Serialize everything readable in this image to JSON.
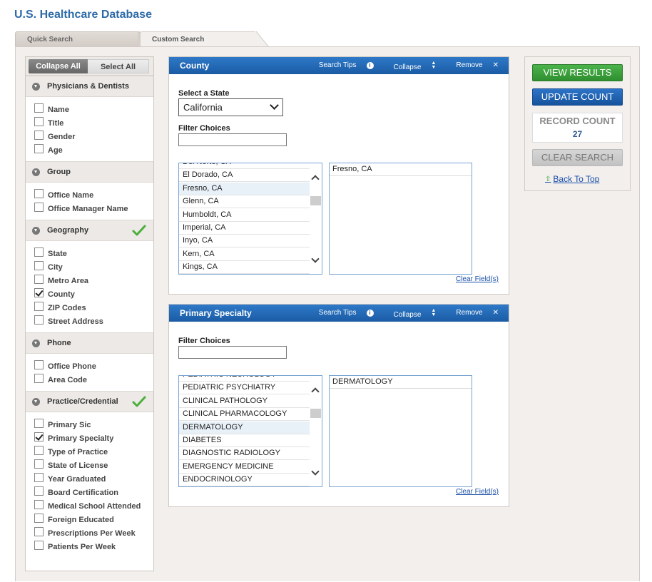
{
  "app": {
    "title": "U.S. Healthcare Database"
  },
  "tabs": [
    {
      "label": "Quick Search"
    },
    {
      "label": "Custom Search"
    }
  ],
  "left_panel": {
    "collapse_all": "Collapse All",
    "select_all": "Select All",
    "groups": [
      {
        "title": "Physicians & Dentists",
        "checked_mark": false,
        "items": [
          {
            "label": "Name",
            "checked": false
          },
          {
            "label": "Title",
            "checked": false
          },
          {
            "label": "Gender",
            "checked": false
          },
          {
            "label": "Age",
            "checked": false
          }
        ]
      },
      {
        "title": "Group",
        "checked_mark": false,
        "items": [
          {
            "label": "Office Name",
            "checked": false
          },
          {
            "label": "Office Manager Name",
            "checked": false
          }
        ]
      },
      {
        "title": "Geography",
        "checked_mark": true,
        "items": [
          {
            "label": "State",
            "checked": false
          },
          {
            "label": "City",
            "checked": false
          },
          {
            "label": "Metro Area",
            "checked": false
          },
          {
            "label": "County",
            "checked": true
          },
          {
            "label": "ZIP Codes",
            "checked": false
          },
          {
            "label": "Street Address",
            "checked": false
          }
        ]
      },
      {
        "title": "Phone",
        "checked_mark": false,
        "items": [
          {
            "label": "Office Phone",
            "checked": false
          },
          {
            "label": "Area Code",
            "checked": false
          }
        ]
      },
      {
        "title": "Practice/Credential",
        "checked_mark": true,
        "items": [
          {
            "label": "Primary Sic",
            "checked": false
          },
          {
            "label": "Primary Specialty",
            "checked": true
          },
          {
            "label": "Type of Practice",
            "checked": false
          },
          {
            "label": "State of License",
            "checked": false
          },
          {
            "label": "Year Graduated",
            "checked": false
          },
          {
            "label": "Board Certification",
            "checked": false
          },
          {
            "label": "Medical School Attended",
            "checked": false
          },
          {
            "label": "Foreign Educated",
            "checked": false
          },
          {
            "label": "Prescriptions Per Week",
            "checked": false
          },
          {
            "label": "Patients Per Week",
            "checked": false
          }
        ]
      }
    ]
  },
  "county_panel": {
    "title": "County",
    "search_tips": "Search Tips",
    "collapse": "Collapse",
    "remove": "Remove",
    "select_state_label": "Select a State",
    "select_state_value": "California",
    "filter_label": "Filter Choices",
    "filter_value": "",
    "options": [
      "Del Norte, CA",
      "El Dorado, CA",
      "Fresno, CA",
      "Glenn, CA",
      "Humboldt, CA",
      "Imperial, CA",
      "Inyo, CA",
      "Kern, CA",
      "Kings, CA"
    ],
    "highlighted": "Fresno, CA",
    "selected": [
      "Fresno, CA"
    ],
    "clear_fields": "Clear Field(s)"
  },
  "specialty_panel": {
    "title": "Primary Specialty",
    "search_tips": "Search Tips",
    "collapse": "Collapse",
    "remove": "Remove",
    "filter_label": "Filter Choices",
    "filter_value": "",
    "options": [
      "PEDIATRIC NEUROLOGY",
      "PEDIATRIC PSYCHIATRY",
      "CLINICAL PATHOLOGY",
      "CLINICAL PHARMACOLOGY",
      "DERMATOLOGY",
      "DIABETES",
      "DIAGNOSTIC RADIOLOGY",
      "EMERGENCY MEDICINE",
      "ENDOCRINOLOGY"
    ],
    "highlighted": "DERMATOLOGY",
    "selected": [
      "DERMATOLOGY"
    ],
    "clear_fields": "Clear Field(s)"
  },
  "right_panel": {
    "view_results": "VIEW RESULTS",
    "update_count": "UPDATE COUNT",
    "record_count_label": "RECORD COUNT",
    "record_count_value": "27",
    "clear_search": "CLEAR SEARCH",
    "back_to_top": "Back To Top"
  },
  "colors": {
    "accent_blue": "#1b5ba4",
    "title_blue": "#2e6ba8",
    "green_button": "#3aa03a",
    "check_green": "#4caf3a"
  }
}
